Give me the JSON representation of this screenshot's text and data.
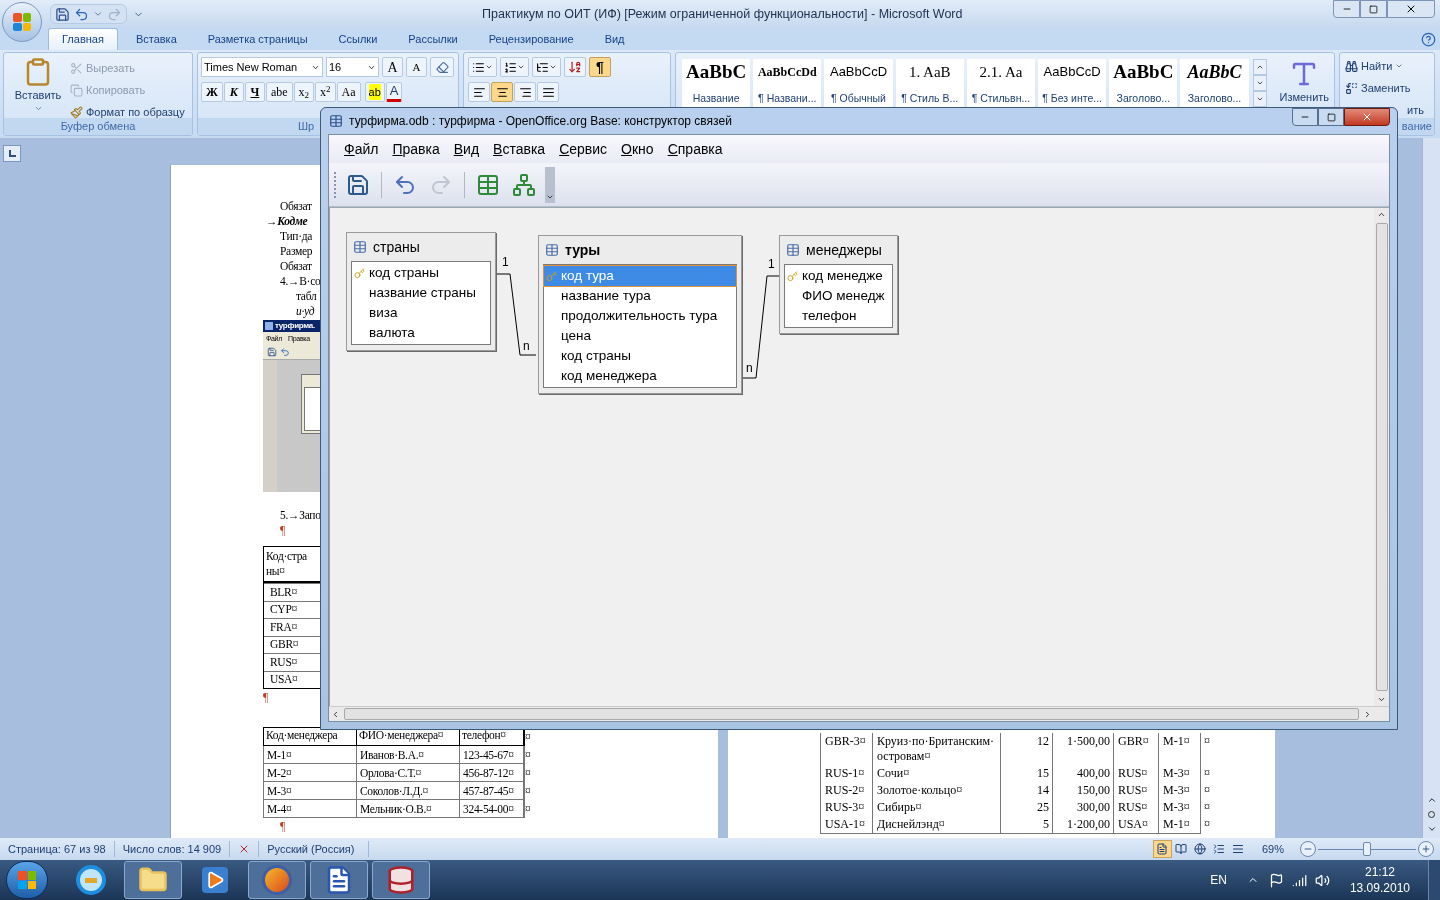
{
  "word": {
    "title": "Практикум по ОИТ (ИФ) [Режим ограниченной функциональности] - Microsoft Word",
    "tabs": [
      {
        "label": "Главная",
        "selected": true
      },
      {
        "label": "Вставка",
        "selected": false
      },
      {
        "label": "Разметка страницы",
        "selected": false
      },
      {
        "label": "Ссылки",
        "selected": false
      },
      {
        "label": "Рассылки",
        "selected": false
      },
      {
        "label": "Рецензирование",
        "selected": false
      },
      {
        "label": "Вид",
        "selected": false
      }
    ],
    "clipboard": {
      "paste": "Вставить",
      "actions": [
        {
          "kind": "cut",
          "label": "Вырезать",
          "disabled": true
        },
        {
          "kind": "copy",
          "label": "Копировать",
          "disabled": true
        },
        {
          "kind": "format",
          "label": "Формат по образцу",
          "disabled": false
        }
      ],
      "group_label": "Буфер обмена"
    },
    "font": {
      "name": "Times New Roman",
      "size": "16",
      "size_buttons": [
        "A",
        "A"
      ],
      "format_buttons": [
        "Ж",
        "К",
        "Ч",
        "abe",
        "x$_{2}$",
        "x$^{2}$",
        "Aa"
      ],
      "highlight": "ab",
      "color_letter": "A",
      "group_label": "Шр"
    },
    "paragraph": {
      "alignments": [
        {
          "kind": "left",
          "selected": false
        },
        {
          "kind": "center",
          "selected": true
        },
        {
          "kind": "right",
          "selected": false
        },
        {
          "kind": "justify",
          "selected": false
        }
      ],
      "marks_button": {
        "label": "¶",
        "selected": true
      }
    },
    "styles": [
      {
        "preview": "AaBbC",
        "name": "Название",
        "kind": "title"
      },
      {
        "preview": "AaBbCcDd",
        "name": "¶ Названи...",
        "kind": "compact"
      },
      {
        "preview": "AaBbCcD",
        "name": "¶ Обычный",
        "kind": "sans"
      },
      {
        "preview": "1. AaB",
        "name": "¶ Стиль В...",
        "kind": "serif"
      },
      {
        "preview": "2.1. Aa",
        "name": "¶ Стильвн...",
        "kind": "serif"
      },
      {
        "preview": "AaBbCcD",
        "name": "¶ Без инте...",
        "kind": "sans"
      },
      {
        "preview": "AaBbC",
        "name": "Заголово...",
        "kind": "heading"
      },
      {
        "preview": "AaBbC",
        "name": "Заголово...",
        "kind": "heading-italic"
      }
    ],
    "change_styles": "Изменить",
    "editing": {
      "find": "Найти",
      "replace": "Заменить",
      "select": "ить",
      "group_label": "вание"
    },
    "left_page": {
      "lines": [
        {
          "text": "Обязат",
          "kind": "plain"
        },
        {
          "text": "→Кодме",
          "kind": "tab-bold-italic"
        },
        {
          "text": "Тип·да",
          "kind": "plain"
        },
        {
          "text": "Размер",
          "kind": "plain"
        },
        {
          "text": "Обязат",
          "kind": "plain"
        },
        {
          "text": "4.→В·со",
          "kind": "plain"
        },
        {
          "text": "табл",
          "kind": "indent"
        },
        {
          "text": "и·уд",
          "kind": "indent-italic"
        }
      ],
      "figure": {
        "title": "турфирма.",
        "menu": [
          "Файл",
          "Правка"
        ]
      },
      "after_lines": [
        "5.→Запо",
        "¶"
      ],
      "countries_table": {
        "header": [
          "Код·стра",
          "ны¤"
        ],
        "rows": [
          "BLR¤",
          "CYP¤",
          "FRA¤",
          "GBR¤",
          "RUS¤",
          "USA¤"
        ]
      },
      "mark_after_countries": "¶",
      "managers_table": {
        "columns": [
          "Код·менеджера",
          "ФИО·менеджера¤",
          "телефон¤"
        ],
        "header_end": "¤",
        "rows": [
          {
            "cells": [
              "M-1¤",
              "Иванов·В.А.¤",
              "123-45-67¤"
            ],
            "end": "¤"
          },
          {
            "cells": [
              "M-2¤",
              "Орлова·С.Т.¤",
              "456-87-12¤"
            ],
            "end": "¤"
          },
          {
            "cells": [
              "M-3¤",
              "Соколов·Л.Д.¤",
              "457-87-45¤"
            ],
            "end": "¤"
          },
          {
            "cells": [
              "M-4¤",
              "Мельник·О.В.¤",
              "324-54-00¤"
            ],
            "end": "¤"
          }
        ]
      },
      "end_mark": "¶"
    },
    "right_page": {
      "rows": [
        {
          "cells": [
            "GBR-3¤",
            [
              "Круиз·по·Британским·",
              "островам¤"
            ],
            "12",
            "1·500,00",
            "GBR¤",
            "M-1¤"
          ],
          "end": "¤"
        },
        {
          "cells": [
            "RUS-1¤",
            "Сочи¤",
            "15",
            "400,00",
            "RUS¤",
            "M-3¤"
          ],
          "end": "¤"
        },
        {
          "cells": [
            "RUS-2¤",
            "Золотое·кольцо¤",
            "14",
            "150,00",
            "RUS¤",
            "M-3¤"
          ],
          "end": "¤"
        },
        {
          "cells": [
            "RUS-3¤",
            "Сибирь¤",
            "25",
            "300,00",
            "RUS¤",
            "M-3¤"
          ],
          "end": "¤"
        },
        {
          "cells": [
            "USA-1¤",
            "Диснейлэнд¤",
            "5",
            "1·200,00",
            "USA¤",
            "M-1¤"
          ],
          "end": "¤"
        }
      ]
    },
    "status_bar": {
      "page": "Страница: 67 из 98",
      "words": "Число слов: 14 909",
      "language": "Русский (Россия)",
      "views": [
        {
          "kind": "print",
          "selected": true
        },
        {
          "kind": "reading",
          "selected": false
        },
        {
          "kind": "web",
          "selected": false
        },
        {
          "kind": "outline",
          "selected": false
        },
        {
          "kind": "draft",
          "selected": false
        }
      ],
      "zoom": "69%",
      "zoom_slider": {
        "level": 0.5
      }
    }
  },
  "base_window": {
    "title": "турфирма.odb : турфирма - OpenOffice.org Base: конструктор связей",
    "menu": [
      "Файл",
      "Правка",
      "Вид",
      "Вставка",
      "Сервис",
      "Окно",
      "Справка"
    ],
    "toolbar": [
      {
        "kind": "save",
        "disabled": false
      },
      {
        "kind": "undo",
        "disabled": false
      },
      {
        "kind": "redo",
        "disabled": true
      },
      {
        "kind": "new-table",
        "disabled": false
      },
      {
        "kind": "new-relation",
        "disabled": false
      }
    ],
    "tables": [
      {
        "name": "страны",
        "focused": false,
        "fields": [
          {
            "name": "код страны",
            "key": true,
            "selected": false
          },
          {
            "name": "название страны",
            "key": false,
            "selected": false
          },
          {
            "name": "виза",
            "key": false,
            "selected": false
          },
          {
            "name": "валюта",
            "key": false,
            "selected": false
          }
        ]
      },
      {
        "name": "туры",
        "focused": true,
        "fields": [
          {
            "name": "код тура",
            "key": true,
            "selected": true
          },
          {
            "name": "название тура",
            "key": false,
            "selected": false
          },
          {
            "name": "продолжительность тура",
            "key": false,
            "selected": false
          },
          {
            "name": "цена",
            "key": false,
            "selected": false
          },
          {
            "name": "код страны",
            "key": false,
            "selected": false
          },
          {
            "name": "код менеджера",
            "key": false,
            "selected": false
          }
        ]
      },
      {
        "name": "менеджеры",
        "focused": false,
        "fields": [
          {
            "name": "код менедже",
            "key": true,
            "selected": false
          },
          {
            "name": "ФИО менедж",
            "key": false,
            "selected": false
          },
          {
            "name": "телефон",
            "key": false,
            "selected": false
          }
        ]
      }
    ],
    "relations": [
      {
        "one": "1",
        "many": "n"
      },
      {
        "one": "1",
        "many": "n"
      }
    ]
  },
  "taskbar": {
    "apps": [
      {
        "kind": "ie",
        "open": false
      },
      {
        "kind": "explorer",
        "open": true
      },
      {
        "kind": "media",
        "open": false
      },
      {
        "kind": "firefox",
        "open": true
      },
      {
        "kind": "word",
        "open": true
      },
      {
        "kind": "base",
        "open": true
      }
    ],
    "language": "EN",
    "time": "21:12",
    "date": "13.09.2010"
  }
}
